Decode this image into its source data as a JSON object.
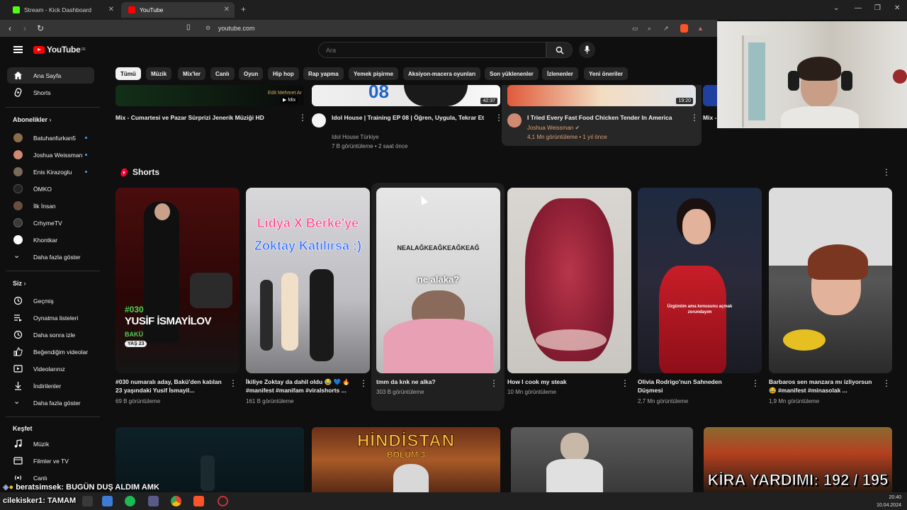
{
  "browser": {
    "tabs": [
      {
        "label": "Stream - Kick Dashboard",
        "active": false,
        "favicon_color": "#53fc18"
      },
      {
        "label": "YouTube",
        "active": true,
        "favicon_color": "#ff0000"
      }
    ],
    "url": "youtube.com"
  },
  "masthead": {
    "logo_text": "YouTube",
    "logo_region": "DE",
    "search_placeholder": "Ara"
  },
  "sidebar": {
    "main": [
      {
        "label": "Ana Sayfa",
        "icon": "home-icon",
        "active": true
      },
      {
        "label": "Shorts",
        "icon": "shorts-icon",
        "active": false
      }
    ],
    "subscriptions_header": "Abonelikler",
    "subscriptions": [
      {
        "label": "Batuhanfurkan5",
        "live": true,
        "color": "#8a6d4b"
      },
      {
        "label": "Joshua Weissman",
        "live": true,
        "color": "#d08a72"
      },
      {
        "label": "Enis Kirazoglu",
        "live": true,
        "color": "#7a6a5a"
      },
      {
        "label": "ÖMKO",
        "live": false,
        "color": "#222222"
      },
      {
        "label": "İlk İnsan",
        "live": false,
        "color": "#6b4e3d"
      },
      {
        "label": "CrhymeTV",
        "live": false,
        "color": "#3a3a3a"
      },
      {
        "label": "Khontkar",
        "live": false,
        "color": "#ffffff"
      }
    ],
    "subs_more": "Daha fazla göster",
    "you_header": "Siz",
    "you": [
      {
        "label": "Geçmiş",
        "icon": "history-icon"
      },
      {
        "label": "Oynatma listeleri",
        "icon": "playlist-icon"
      },
      {
        "label": "Daha sonra izle",
        "icon": "clock-icon"
      },
      {
        "label": "Beğendiğim videolar",
        "icon": "like-icon"
      },
      {
        "label": "Videolarınız",
        "icon": "video-icon"
      },
      {
        "label": "İndirilenler",
        "icon": "download-icon"
      }
    ],
    "you_more": "Daha fazla göster",
    "explore_header": "Keşfet",
    "explore": [
      {
        "label": "Müzik",
        "icon": "music-icon"
      },
      {
        "label": "Filmler ve TV",
        "icon": "film-icon"
      },
      {
        "label": "Canlı",
        "icon": "live-icon"
      }
    ]
  },
  "chips": [
    "Tümü",
    "Müzik",
    "Mix'ler",
    "Canlı",
    "Oyun",
    "Hip hop",
    "Rap yapma",
    "Yemek pişirme",
    "Aksiyon-macera oyunları",
    "Son yüklenenler",
    "İzlenenler",
    "Yeni öneriler"
  ],
  "top_videos": [
    {
      "title": "Mix - Cumartesi ve Pazar Sürprizi Jenerik Müziği HD",
      "badge": "Mix",
      "thumb_text": "Edit Mehmet Ar"
    },
    {
      "title": "Idol House | Training EP 08 | Öğren, Uygula, Tekrar Et",
      "channel": "Idol House Türkiye",
      "views": "7 B görüntüleme • 2 saat önce",
      "duration": "42:37"
    },
    {
      "title": "I Tried Every Fast Food Chicken Tender In America",
      "channel": "Joshua Weissman",
      "views": "4,1 Mn görüntüleme • 1 yıl önce",
      "duration": "19:20"
    },
    {
      "title": "Mix - Saçma..."
    }
  ],
  "shorts_header": "Shorts",
  "shorts": [
    {
      "title": "#030 numaralı aday, Bakü'den katılan 23 yaşındaki Yusif İsmayil...",
      "views": "69 B görüntüleme",
      "overlay": [
        "#030",
        "YUSİF İSMAYİLOV",
        "BAKÜ",
        "YAŞ 23"
      ]
    },
    {
      "title": "İkiliye Zoktay da dahil oldu 😂 💙 🔥 #manifest #manifam #viralshorts ...",
      "views": "161 B görüntüleme",
      "overlay": [
        "Lidya X Berke'ye",
        "Zoktay Katılırsa :)"
      ]
    },
    {
      "title": "tmm da knk ne alka?",
      "views": "303 B görüntüleme",
      "overlay": [
        "NEALAĞKEAĞKEAĞKEAĞ",
        "ne alaka?"
      ]
    },
    {
      "title": "How I cook my steak",
      "views": "10 Mn görüntüleme",
      "overlay": []
    },
    {
      "title": "Olivia Rodrigo'nun Sahneden Düşmesi",
      "views": "2,7 Mn görüntüleme",
      "overlay": [
        "Üzgünüm ama konusunu açmak zorundayım"
      ]
    },
    {
      "title": "Barbaros sen manzara mı izliyorsun 😂 #manifest #minasolak ...",
      "views": "1,9 Mn görüntüleme",
      "overlay": []
    }
  ],
  "bottom_row": [
    {
      "thumb_text": ""
    },
    {
      "thumb_text": "HİNDİSTAN",
      "sub": "BÖLÜM 3"
    },
    {
      "thumb_text": ""
    },
    {
      "thumb_text": "KİRA YARDIMI: 192 / 195"
    }
  ],
  "chat": [
    {
      "user": "beratsimsek",
      "message": ": BUGÜN DUŞ ALDIM AMK"
    },
    {
      "user": "cilekisker1",
      "message": ": TAMAM"
    }
  ],
  "taskbar": {
    "time": "20:40",
    "date": "10.04.2024"
  }
}
